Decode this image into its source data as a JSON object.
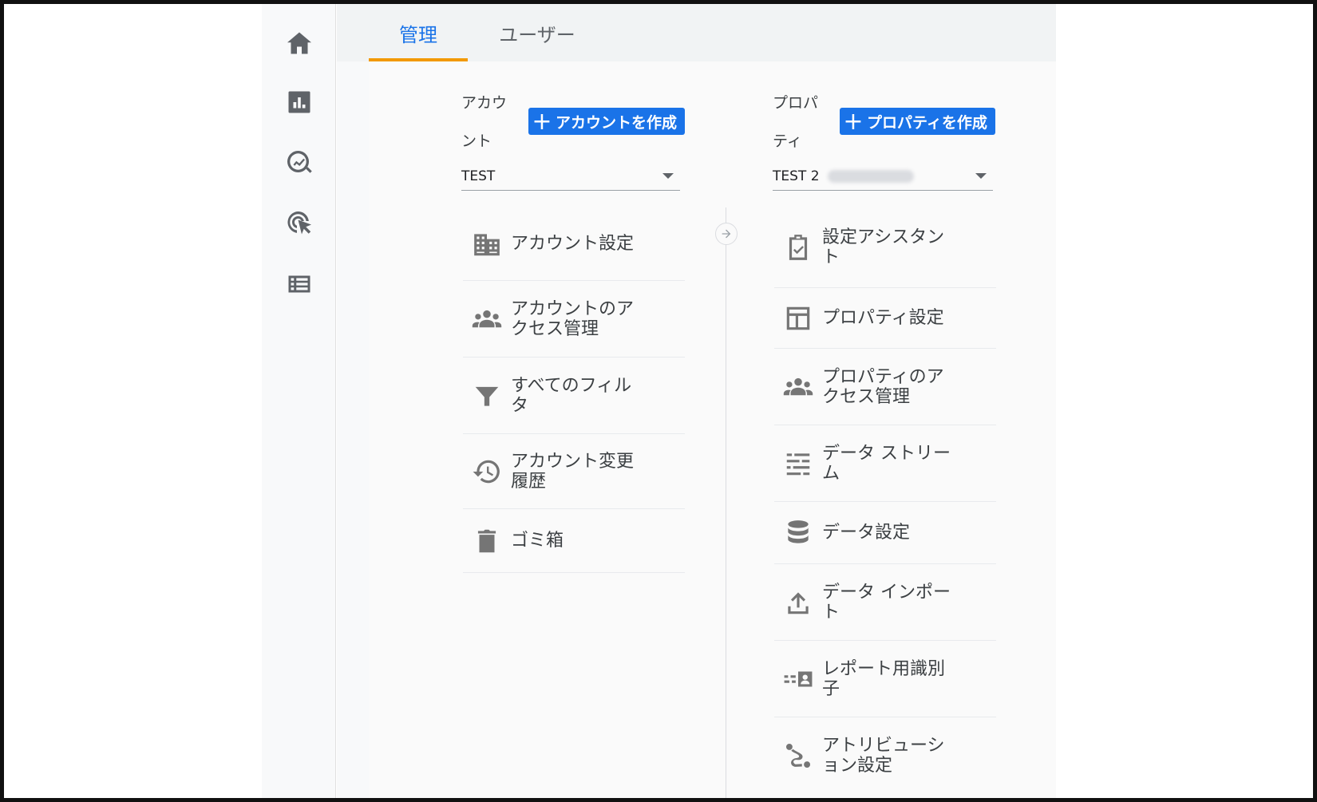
{
  "tabs": [
    {
      "label": "管理",
      "active": true
    },
    {
      "label": "ユーザー",
      "active": false
    }
  ],
  "nav_rail": [
    {
      "icon": "home-icon"
    },
    {
      "icon": "reports-icon"
    },
    {
      "icon": "explore-icon"
    },
    {
      "icon": "advertising-icon"
    },
    {
      "icon": "configure-icon"
    }
  ],
  "account": {
    "label": "アカウント",
    "create_button": "アカウントを作成",
    "selected": "TEST",
    "items": [
      {
        "icon": "building-icon",
        "label": "アカウント設定"
      },
      {
        "icon": "people-icon",
        "label": "アカウントのアクセス管理"
      },
      {
        "icon": "filter-icon",
        "label": "すべてのフィルタ"
      },
      {
        "icon": "history-icon",
        "label": "アカウント変更履歴"
      },
      {
        "icon": "trash-icon",
        "label": "ゴミ箱"
      }
    ]
  },
  "property": {
    "label": "プロパティ",
    "create_button": "プロパティを作成",
    "selected": "TEST 2",
    "items": [
      {
        "icon": "checklist-icon",
        "label": "設定アシスタント"
      },
      {
        "icon": "layout-icon",
        "label": "プロパティ設定"
      },
      {
        "icon": "people-icon",
        "label": "プロパティのアクセス管理"
      },
      {
        "icon": "data-streams-icon",
        "label": "データ ストリーム"
      },
      {
        "icon": "database-icon",
        "label": "データ設定"
      },
      {
        "icon": "upload-icon",
        "label": "データ インポート"
      },
      {
        "icon": "id-card-icon",
        "label": "レポート用識別子"
      },
      {
        "icon": "attribution-icon",
        "label": "アトリビューション設定"
      }
    ]
  },
  "colors": {
    "accent": "#1a73e8",
    "tab_indicator": "#f29900",
    "icon": "#757575"
  }
}
